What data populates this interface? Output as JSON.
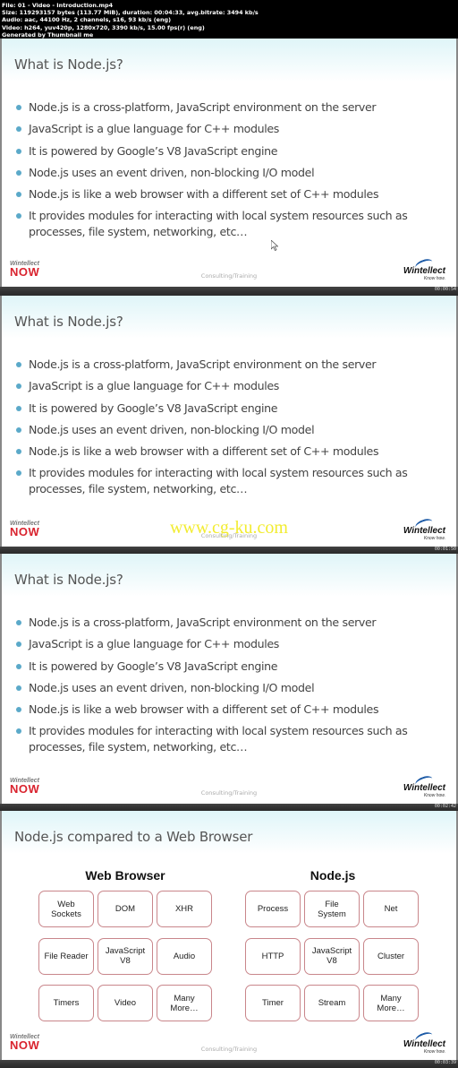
{
  "header": {
    "lines": [
      "File: 01 - Video - Introduction.mp4",
      "Size: 119293157 bytes (113.77 MiB), duration: 00:04:33, avg.bitrate: 3494 kb/s",
      "Audio: aac, 44100 Hz, 2 channels, s16, 93 kb/s (eng)",
      "Video: h264, yuv420p, 1280x720, 3390 kb/s, 15.00 fps(r) (eng)",
      "Generated by Thumbnail me"
    ]
  },
  "slides": [
    {
      "title": "What is Node.js?",
      "bullets": [
        "Node.js is a cross-platform, JavaScript environment on the server",
        "JavaScript is a glue language for C++ modules",
        "It is powered by Google’s V8 JavaScript engine",
        "Node.js uses an event driven, non-blocking I/O model",
        "Node.js is like a web browser with a different set of C++ modules",
        "It provides modules for interacting with local system resources such as processes, file system, networking, etc…"
      ],
      "timestamp": "00:00:54"
    },
    {
      "title": "What is Node.js?",
      "bullets": [
        "Node.js is a cross-platform, JavaScript environment on the server",
        "JavaScript is a glue language for C++ modules",
        "It is powered by Google’s V8 JavaScript engine",
        "Node.js uses an event driven, non-blocking I/O model",
        "Node.js is like a web browser with a different set of C++ modules",
        "It provides modules for interacting with local system resources such as processes, file system, networking, etc…"
      ],
      "watermark": "www.cg-ku.com",
      "timestamp": "00:01:50"
    },
    {
      "title": "What is Node.js?",
      "bullets": [
        "Node.js is a cross-platform, JavaScript environment on the server",
        "JavaScript is a glue language for C++ modules",
        "It is powered by Google’s V8 JavaScript engine",
        "Node.js uses an event driven, non-blocking I/O model",
        "Node.js is like a web browser with a different set of C++ modules",
        "It provides modules for interacting with local system resources such as processes, file system, networking, etc…"
      ],
      "timestamp": "00:02:42"
    },
    {
      "title": "Node.js compared to a Web Browser",
      "left_heading": "Web Browser",
      "right_heading": "Node.js",
      "left_boxes": [
        "Web\nSockets",
        "DOM",
        "XHR",
        "File Reader",
        "JavaScript\nV8",
        "Audio",
        "Timers",
        "Video",
        "Many\nMore…"
      ],
      "right_boxes": [
        "Process",
        "File\nSystem",
        "Net",
        "HTTP",
        "JavaScript\nV8",
        "Cluster",
        "Timer",
        "Stream",
        "Many\nMore…"
      ],
      "timestamp": "00:03:39"
    }
  ],
  "footer": {
    "left_brand": "Wintellect",
    "left_now": "NOW",
    "center": "Consulting/Training",
    "right_brand": "Wintellect",
    "right_tagline": "Know how."
  },
  "colors": {
    "bullet": "#5ba9c9",
    "now_red": "#d9232e",
    "box_border": "#c9868b",
    "watermark": "#f1ea1a"
  }
}
